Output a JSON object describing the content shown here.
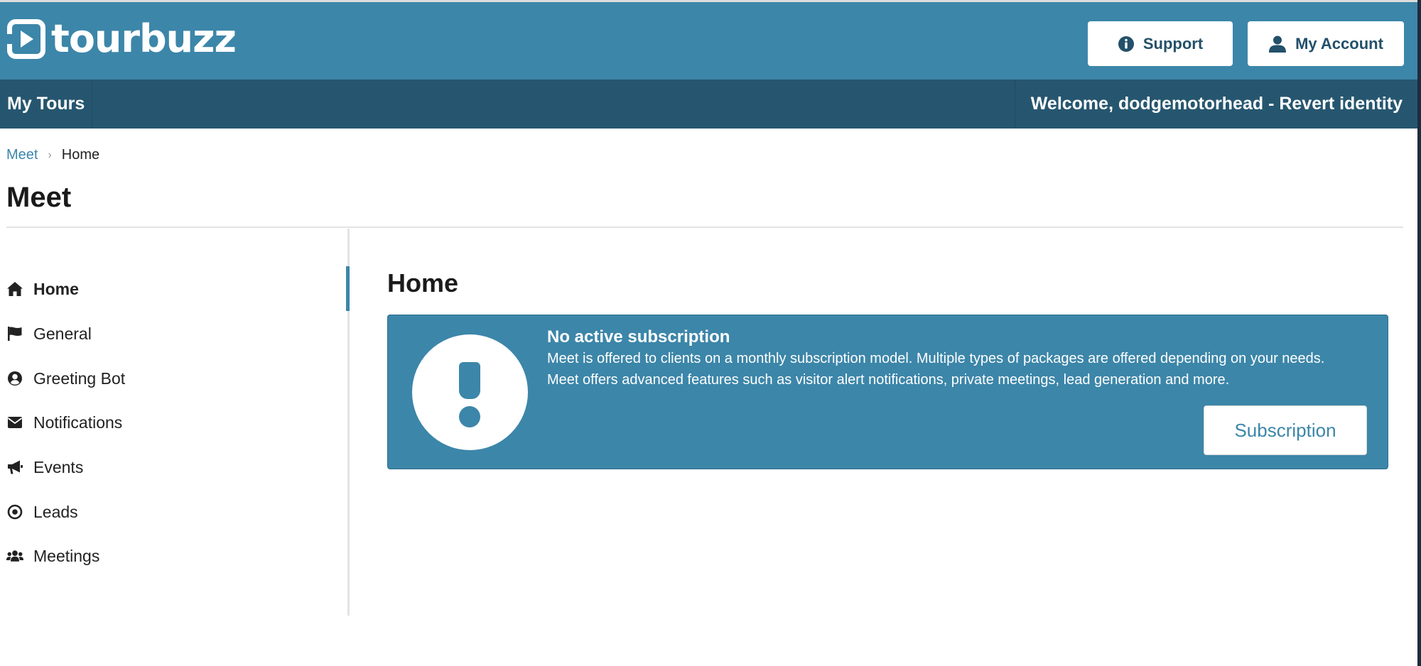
{
  "header": {
    "logo_text": "tourbuzz",
    "support_label": "Support",
    "account_label": "My Account"
  },
  "navbar": {
    "my_tours": "My Tours",
    "welcome": "Welcome, dodgemotorhead - Revert identity"
  },
  "breadcrumb": {
    "parent": "Meet",
    "current": "Home"
  },
  "page": {
    "title": "Meet"
  },
  "sidebar": {
    "items": [
      {
        "label": "Home",
        "icon": "home-icon",
        "active": true
      },
      {
        "label": "General",
        "icon": "flag-icon",
        "active": false
      },
      {
        "label": "Greeting Bot",
        "icon": "user-circle-icon",
        "active": false
      },
      {
        "label": "Notifications",
        "icon": "envelope-icon",
        "active": false
      },
      {
        "label": "Events",
        "icon": "bullhorn-icon",
        "active": false
      },
      {
        "label": "Leads",
        "icon": "target-icon",
        "active": false
      },
      {
        "label": "Meetings",
        "icon": "users-icon",
        "active": false
      }
    ]
  },
  "content": {
    "title": "Home",
    "alert": {
      "icon": "exclamation-icon",
      "heading": "No active subscription",
      "line1": "Meet is offered to clients on a monthly subscription model. Multiple types of packages are offered depending on your needs.",
      "line2": "Meet offers advanced features such as visitor alert notifications, private meetings, lead generation and more.",
      "button_label": "Subscription"
    }
  },
  "colors": {
    "header_bg": "#3c86a9",
    "navbar_bg": "#26566f",
    "accent": "#3c86a9"
  }
}
